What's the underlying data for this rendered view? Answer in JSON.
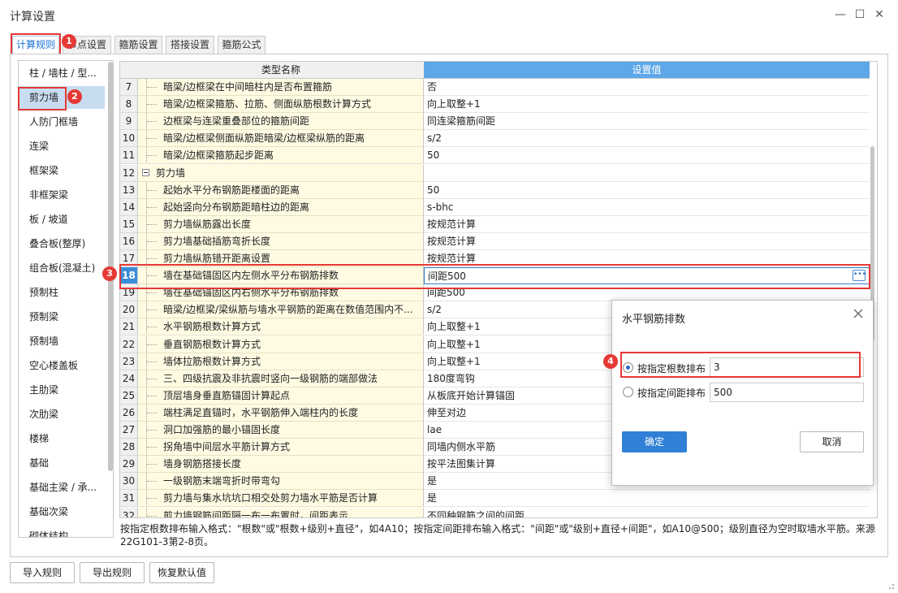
{
  "window": {
    "title": "计算设置",
    "min_glyph": "—",
    "max_glyph": "☐",
    "close_glyph": "✕"
  },
  "tabs": [
    "计算规则",
    "节点设置",
    "箍筋设置",
    "搭接设置",
    "箍筋公式"
  ],
  "sidebar": {
    "items": [
      "柱 / 墙柱 / 型...",
      "剪力墙",
      "人防门框墙",
      "连梁",
      "框架梁",
      "非框架梁",
      "板 / 坡道",
      "叠合板(整厚)",
      "组合板(混凝土)",
      "预制柱",
      "预制梁",
      "预制墙",
      "空心楼盖板",
      "主肋梁",
      "次肋梁",
      "楼梯",
      "基础",
      "基础主梁 / 承...",
      "基础次梁",
      "砌体结构"
    ],
    "selected": "剪力墙"
  },
  "table": {
    "headers": [
      "类型名称",
      "设置值"
    ],
    "rows": [
      {
        "num": "7",
        "name": "暗梁/边框梁在中间暗柱内是否布置箍筋",
        "value": "否"
      },
      {
        "num": "8",
        "name": "暗梁/边框梁箍筋、拉筋、侧面纵筋根数计算方式",
        "value": "向上取整+1"
      },
      {
        "num": "9",
        "name": "边框梁与连梁重叠部位的箍筋间距",
        "value": "同连梁箍筋间距"
      },
      {
        "num": "10",
        "name": "暗梁/边框梁侧面纵筋距暗梁/边框梁纵筋的距离",
        "value": "s/2"
      },
      {
        "num": "11",
        "name": "暗梁/边框梁箍筋起步距离",
        "value": "50"
      },
      {
        "num": "12",
        "name": "剪力墙",
        "value": "",
        "group": true
      },
      {
        "num": "13",
        "name": "起始水平分布钢筋距楼面的距离",
        "value": "50"
      },
      {
        "num": "14",
        "name": "起始竖向分布钢筋距暗柱边的距离",
        "value": "s-bhc"
      },
      {
        "num": "15",
        "name": "剪力墙纵筋露出长度",
        "value": "按规范计算"
      },
      {
        "num": "16",
        "name": "剪力墙基础插筋弯折长度",
        "value": "按规范计算"
      },
      {
        "num": "17",
        "name": "剪力墙纵筋错开距离设置",
        "value": "按规范计算"
      },
      {
        "num": "18",
        "name": "墙在基础锚固区内左侧水平分布钢筋排数",
        "value": "间距500",
        "selected": true
      },
      {
        "num": "19",
        "name": "墙在基础锚固区内右侧水平分布钢筋排数",
        "value": "间距500"
      },
      {
        "num": "20",
        "name": "暗梁/边框梁/梁纵筋与墙水平钢筋的距离在数值范围内不...",
        "value": "s/2"
      },
      {
        "num": "21",
        "name": "水平钢筋根数计算方式",
        "value": "向上取整+1"
      },
      {
        "num": "22",
        "name": "垂直钢筋根数计算方式",
        "value": "向上取整+1"
      },
      {
        "num": "23",
        "name": "墙体拉筋根数计算方式",
        "value": "向上取整+1"
      },
      {
        "num": "24",
        "name": "三、四级抗震及非抗震时竖向一级钢筋的端部做法",
        "value": "180度弯钩"
      },
      {
        "num": "25",
        "name": "顶层墙身垂直筋锚固计算起点",
        "value": "从板底开始计算锚固"
      },
      {
        "num": "26",
        "name": "端柱满足直锚时，水平钢筋伸入端柱内的长度",
        "value": "伸至对边"
      },
      {
        "num": "27",
        "name": "洞口加强筋的最小锚固长度",
        "value": "lae"
      },
      {
        "num": "28",
        "name": "拐角墙中间层水平筋计算方式",
        "value": "同墙内侧水平筋"
      },
      {
        "num": "29",
        "name": "墙身钢筋搭接长度",
        "value": "按平法图集计算"
      },
      {
        "num": "30",
        "name": "一级钢筋末端弯折时带弯勾",
        "value": "是"
      },
      {
        "num": "31",
        "name": "剪力墙与集水坑坑口相交处剪力墙水平筋是否计算",
        "value": "是"
      },
      {
        "num": "32",
        "name": "剪力墙钢筋间距隔一布一布置时，间距表示",
        "value": "不同种钢筋之间的间距"
      }
    ]
  },
  "note": "按指定根数排布输入格式：\"根数\"或\"根数+级别+直径\"，如4A10；按指定间距排布输入格式：\"间距\"或\"级别+直径+间距\"，如A10@500；级别直径为空时取墙水平筋。来源22G101-3第2-8页。",
  "buttons": {
    "import": "导入规则",
    "export": "导出规则",
    "restore": "恢复默认值"
  },
  "annotations": [
    "1",
    "2",
    "3",
    "4"
  ],
  "dialog": {
    "title": "水平钢筋排数",
    "option1": {
      "label": "按指定根数排布",
      "value": "3",
      "checked": true
    },
    "option2": {
      "label": "按指定间距排布",
      "value": "500",
      "checked": false
    },
    "ok": "确定",
    "cancel": "取消"
  },
  "colors": {
    "accent": "#2f80d6",
    "annotation": "#e53935",
    "name_cell": "#fffbe3",
    "selected_item": "#c8dcf0"
  }
}
